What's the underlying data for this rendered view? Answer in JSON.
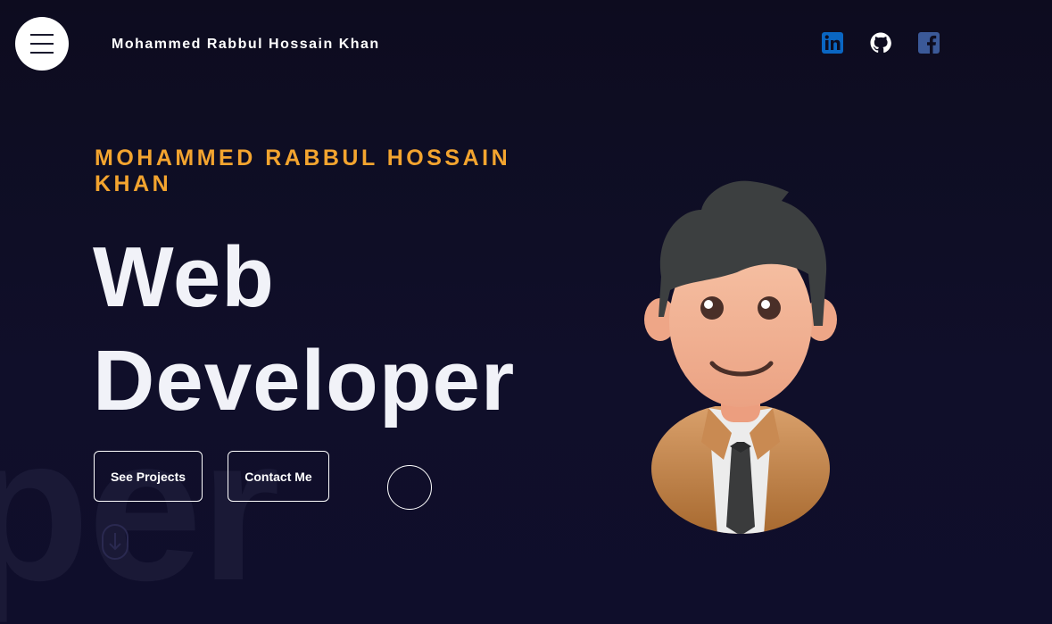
{
  "header": {
    "brand": "Mohammed Rabbul Hossain Khan",
    "menu_icon": "hamburger-icon",
    "socials": [
      {
        "icon": "linkedin-icon",
        "color": "#0a66c2"
      },
      {
        "icon": "github-icon",
        "color": "#ffffff"
      },
      {
        "icon": "facebook-icon",
        "color": "#3b5998"
      }
    ]
  },
  "hero": {
    "subtitle": "MOHAMMED RABBUL HOSSAIN KHAN",
    "headline_line1": "Web",
    "headline_line2": "Developer",
    "background_word": "per",
    "buttons": {
      "projects": "See Projects",
      "contact": "Contact Me"
    },
    "scroll_icon": "scroll-down-icon",
    "avatar": "developer-avatar-illustration"
  },
  "colors": {
    "background": "#0e0d25",
    "accent": "#f3a42f",
    "text": "#f1f2f8"
  }
}
